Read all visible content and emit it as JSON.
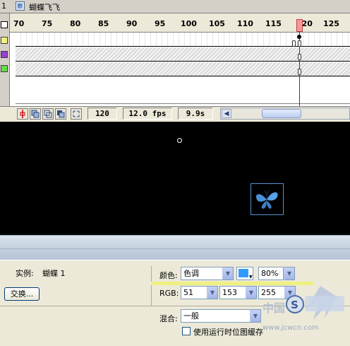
{
  "tab": {
    "number": "1",
    "title": "蝴蝶飞飞"
  },
  "ruler": {
    "labels": [
      "70",
      "75",
      "80",
      "85",
      "90",
      "95",
      "100",
      "105",
      "110",
      "115",
      "120",
      "125"
    ]
  },
  "layers": [
    {
      "color": "#f2f27a"
    },
    {
      "color": "#9b3fcf"
    },
    {
      "color": "#6ad84a"
    }
  ],
  "status": {
    "current_frame": "120",
    "fps": "12.0 fps",
    "elapsed": "9.9s"
  },
  "properties": {
    "instance_label": "实例:",
    "instance_name": "蝴蝶 1",
    "swap_button": "交换...",
    "color_label": "颜色:",
    "color_mode": "色调",
    "tint_color": "#3399ff",
    "tint_amount": "80%",
    "rgb_label": "RGB:",
    "r": "51",
    "g": "153",
    "b": "255",
    "blend_label": "混合:",
    "blend_mode": "一般",
    "bitmap_cache_label": "使用运行时位图缓存"
  },
  "watermark": {
    "text": "中国",
    "url": "www.jcwcn.com"
  }
}
